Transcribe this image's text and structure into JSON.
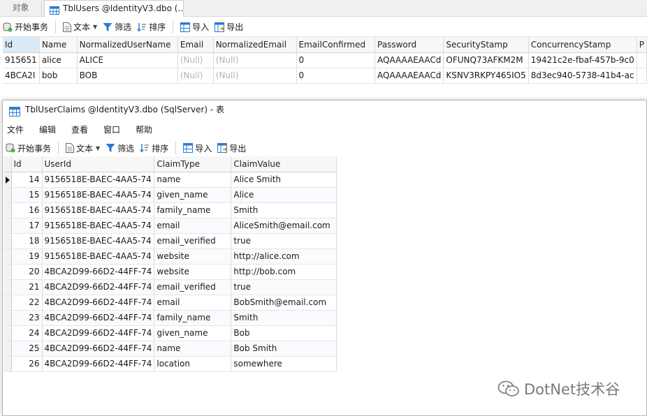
{
  "back_window": {
    "tabs": [
      {
        "label": "对象"
      },
      {
        "label": "TblUsers @IdentityV3.dbo (..."
      }
    ],
    "toolbar": {
      "begin_transaction": "开始事务",
      "text": "文本",
      "filter": "筛选",
      "sort": "排序",
      "import": "导入",
      "export": "导出"
    },
    "grid": {
      "columns": [
        "Id",
        "Name",
        "NormalizedUserName",
        "Email",
        "NormalizedEmail",
        "EmailConfirmed",
        "Password",
        "SecurityStamp",
        "ConcurrencyStamp",
        "P"
      ],
      "rows": [
        [
          "915651",
          "alice",
          "ALICE",
          "(Null)",
          "(Null)",
          "0",
          "AQAAAAEAACd",
          "OFUNQ73AFKM2M",
          "19421c2e-fbaf-457b-9c0",
          ""
        ],
        [
          "4BCA2I",
          "bob",
          "BOB",
          "(Null)",
          "(Null)",
          "0",
          "AQAAAAEAACd",
          "KSNV3RKPY465IO5",
          "8d3ec940-5738-41b4-ac",
          ""
        ]
      ]
    }
  },
  "front_window": {
    "title": "TblUserClaims @IdentityV3.dbo (SqlServer) - 表",
    "menu": [
      "文件",
      "编辑",
      "查看",
      "窗口",
      "帮助"
    ],
    "toolbar": {
      "begin_transaction": "开始事务",
      "text": "文本",
      "filter": "筛选",
      "sort": "排序",
      "import": "导入",
      "export": "导出"
    },
    "grid": {
      "columns": [
        "Id",
        "UserId",
        "ClaimType",
        "ClaimValue"
      ],
      "rows": [
        [
          "14",
          "9156518E-BAEC-4AA5-74",
          "name",
          "Alice Smith"
        ],
        [
          "15",
          "9156518E-BAEC-4AA5-74",
          "given_name",
          "Alice"
        ],
        [
          "16",
          "9156518E-BAEC-4AA5-74",
          "family_name",
          "Smith"
        ],
        [
          "17",
          "9156518E-BAEC-4AA5-74",
          "email",
          "AliceSmith@email.com"
        ],
        [
          "18",
          "9156518E-BAEC-4AA5-74",
          "email_verified",
          "true"
        ],
        [
          "19",
          "9156518E-BAEC-4AA5-74",
          "website",
          "http://alice.com"
        ],
        [
          "20",
          "4BCA2D99-66D2-44FF-74",
          "website",
          "http://bob.com"
        ],
        [
          "21",
          "4BCA2D99-66D2-44FF-74",
          "email_verified",
          "true"
        ],
        [
          "22",
          "4BCA2D99-66D2-44FF-74",
          "email",
          "BobSmith@email.com"
        ],
        [
          "23",
          "4BCA2D99-66D2-44FF-74",
          "family_name",
          "Smith"
        ],
        [
          "24",
          "4BCA2D99-66D2-44FF-74",
          "given_name",
          "Bob"
        ],
        [
          "25",
          "4BCA2D99-66D2-44FF-74",
          "name",
          "Bob Smith"
        ],
        [
          "26",
          "4BCA2D99-66D2-44FF-74",
          "location",
          "somewhere"
        ]
      ],
      "selected_row": 0
    }
  },
  "watermark": {
    "text": "DotNet技术谷"
  },
  "icons": {
    "table": "table-icon",
    "transaction": "database-transaction-icon",
    "text": "document-text-icon",
    "filter": "funnel-filter-icon",
    "sort": "sort-icon",
    "import": "import-icon",
    "export": "export-icon",
    "watermark": "wechat-icon"
  },
  "colors": {
    "accent": "#2a7bd1",
    "header_selected": "#dbeaf7",
    "null_text": "#b5b5b5"
  }
}
